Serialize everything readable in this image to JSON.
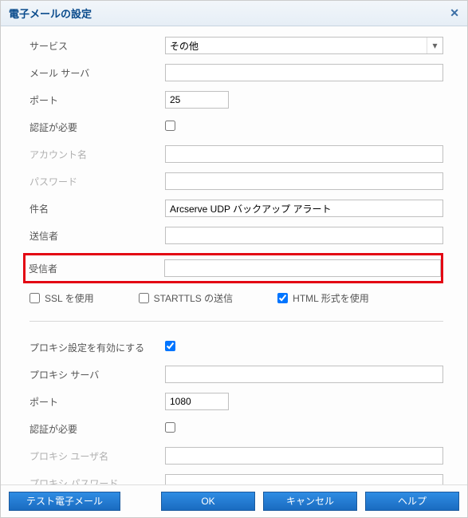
{
  "title": "電子メールの設定",
  "labels": {
    "service": "サービス",
    "mail_server": "メール サーバ",
    "port": "ポート",
    "auth_required": "認証が必要",
    "account_name": "アカウント名",
    "password": "パスワード",
    "subject": "件名",
    "sender": "送信者",
    "recipients": "受信者",
    "ssl": "SSL を使用",
    "starttls": "STARTTLS の送信",
    "html_format": "HTML 形式を使用",
    "proxy_enable": "プロキシ設定を有効にする",
    "proxy_server": "プロキシ サーバ",
    "proxy_port": "ポート",
    "proxy_auth": "認証が必要",
    "proxy_user": "プロキシ ユーザ名",
    "proxy_password": "プロキシ パスワード"
  },
  "values": {
    "service": "その他",
    "mail_server": "",
    "port": "25",
    "auth_required": false,
    "account_name": "",
    "password": "",
    "subject": "Arcserve UDP バックアップ アラート",
    "sender": "",
    "recipients": "",
    "ssl": false,
    "starttls": false,
    "html_format": true,
    "proxy_enable": true,
    "proxy_server": "",
    "proxy_port": "1080",
    "proxy_auth": false,
    "proxy_user": "",
    "proxy_password": ""
  },
  "buttons": {
    "test": "テスト電子メール",
    "ok": "OK",
    "cancel": "キャンセル",
    "help": "ヘルプ"
  }
}
